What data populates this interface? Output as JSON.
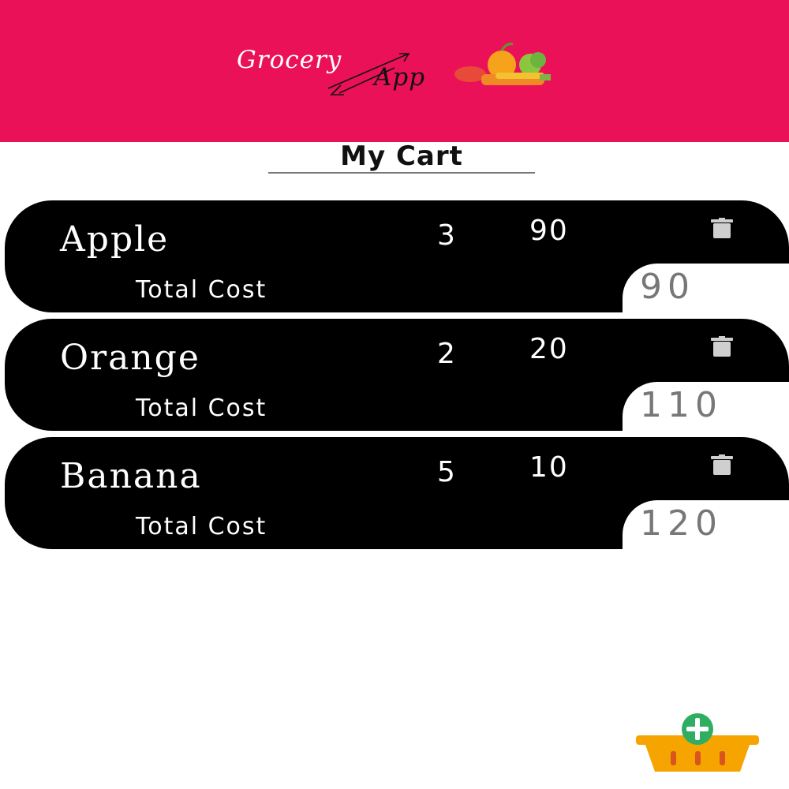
{
  "app": {
    "logo_word1": "Grocery",
    "logo_word2": "App"
  },
  "page_title": "My Cart",
  "cart_items": [
    {
      "name": "Apple",
      "quantity": "3",
      "price": "90",
      "total_label": "Total Cost",
      "total_value": "90"
    },
    {
      "name": "Orange",
      "quantity": "2",
      "price": "20",
      "total_label": "Total Cost",
      "total_value": "110"
    },
    {
      "name": "Banana",
      "quantity": "5",
      "price": "10",
      "total_label": "Total Cost",
      "total_value": "120"
    }
  ],
  "icons": {
    "delete": "trash-icon",
    "add_to_basket": "basket-add-icon",
    "logo_art": "vegetables-icon"
  },
  "colors": {
    "header": "#ea1158",
    "card": "#000000",
    "total_text": "#777777",
    "fab_plus": "#2fae62",
    "basket": "#f5a400"
  }
}
